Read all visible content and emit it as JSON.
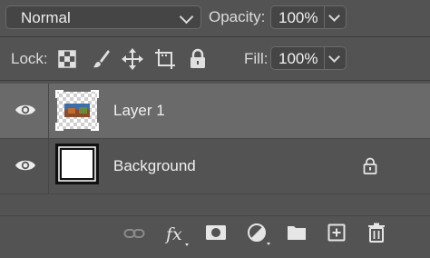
{
  "blend_mode": {
    "value": "Normal"
  },
  "opacity": {
    "label": "Opacity:",
    "value": "100%"
  },
  "lock": {
    "label": "Lock:"
  },
  "fill": {
    "label": "Fill:",
    "value": "100%"
  },
  "layers": [
    {
      "name": "Layer 1",
      "selected": true,
      "visible": true
    },
    {
      "name": "Background",
      "selected": false,
      "visible": true,
      "locked": true
    }
  ],
  "footer_icons": [
    "link-icon",
    "fx-icon",
    "layer-mask-icon",
    "adjustment-layer-icon",
    "group-folder-icon",
    "new-layer-icon",
    "trash-icon"
  ],
  "colors": {
    "panel_bg": "#535353",
    "selected_row": "#6a6a6a",
    "input_bg": "#454545"
  }
}
